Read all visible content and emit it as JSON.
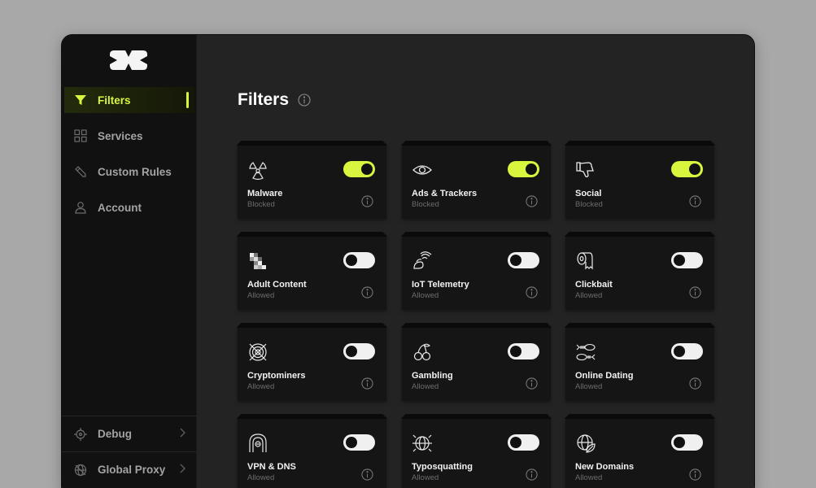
{
  "nav": {
    "items": [
      {
        "label": "Filters",
        "icon": "filter-icon",
        "active": true
      },
      {
        "label": "Services",
        "icon": "grid-icon",
        "active": false
      },
      {
        "label": "Custom Rules",
        "icon": "pencil-icon",
        "active": false
      },
      {
        "label": "Account",
        "icon": "user-icon",
        "active": false
      }
    ],
    "bottom": [
      {
        "label": "Debug",
        "icon": "crosshair-icon"
      },
      {
        "label": "Global Proxy",
        "icon": "globe-icon"
      }
    ]
  },
  "main": {
    "title": "Filters"
  },
  "filters": [
    {
      "name": "Malware",
      "status": "Blocked",
      "enabled": true,
      "icon": "radiation-icon"
    },
    {
      "name": "Ads & Trackers",
      "status": "Blocked",
      "enabled": true,
      "icon": "eye-icon"
    },
    {
      "name": "Social",
      "status": "Blocked",
      "enabled": true,
      "icon": "thumbs-down-icon"
    },
    {
      "name": "Adult Content",
      "status": "Allowed",
      "enabled": false,
      "icon": "pixelated-icon"
    },
    {
      "name": "IoT Telemetry",
      "status": "Allowed",
      "enabled": false,
      "icon": "signal-device-icon"
    },
    {
      "name": "Clickbait",
      "status": "Allowed",
      "enabled": false,
      "icon": "toilet-paper-icon"
    },
    {
      "name": "Cryptominers",
      "status": "Allowed",
      "enabled": false,
      "icon": "crypto-target-icon"
    },
    {
      "name": "Gambling",
      "status": "Allowed",
      "enabled": false,
      "icon": "cherries-icon"
    },
    {
      "name": "Online Dating",
      "status": "Allowed",
      "enabled": false,
      "icon": "fish-bones-icon"
    },
    {
      "name": "VPN & DNS",
      "status": "Allowed",
      "enabled": false,
      "icon": "tunnel-icon"
    },
    {
      "name": "Typosquatting",
      "status": "Allowed",
      "enabled": false,
      "icon": "globe-bug-icon"
    },
    {
      "name": "New Domains",
      "status": "Allowed",
      "enabled": false,
      "icon": "globe-leaf-icon"
    }
  ],
  "colors": {
    "accent": "#d9f53d",
    "sidebar": "#111111",
    "main": "#232323",
    "card": "#151515"
  }
}
